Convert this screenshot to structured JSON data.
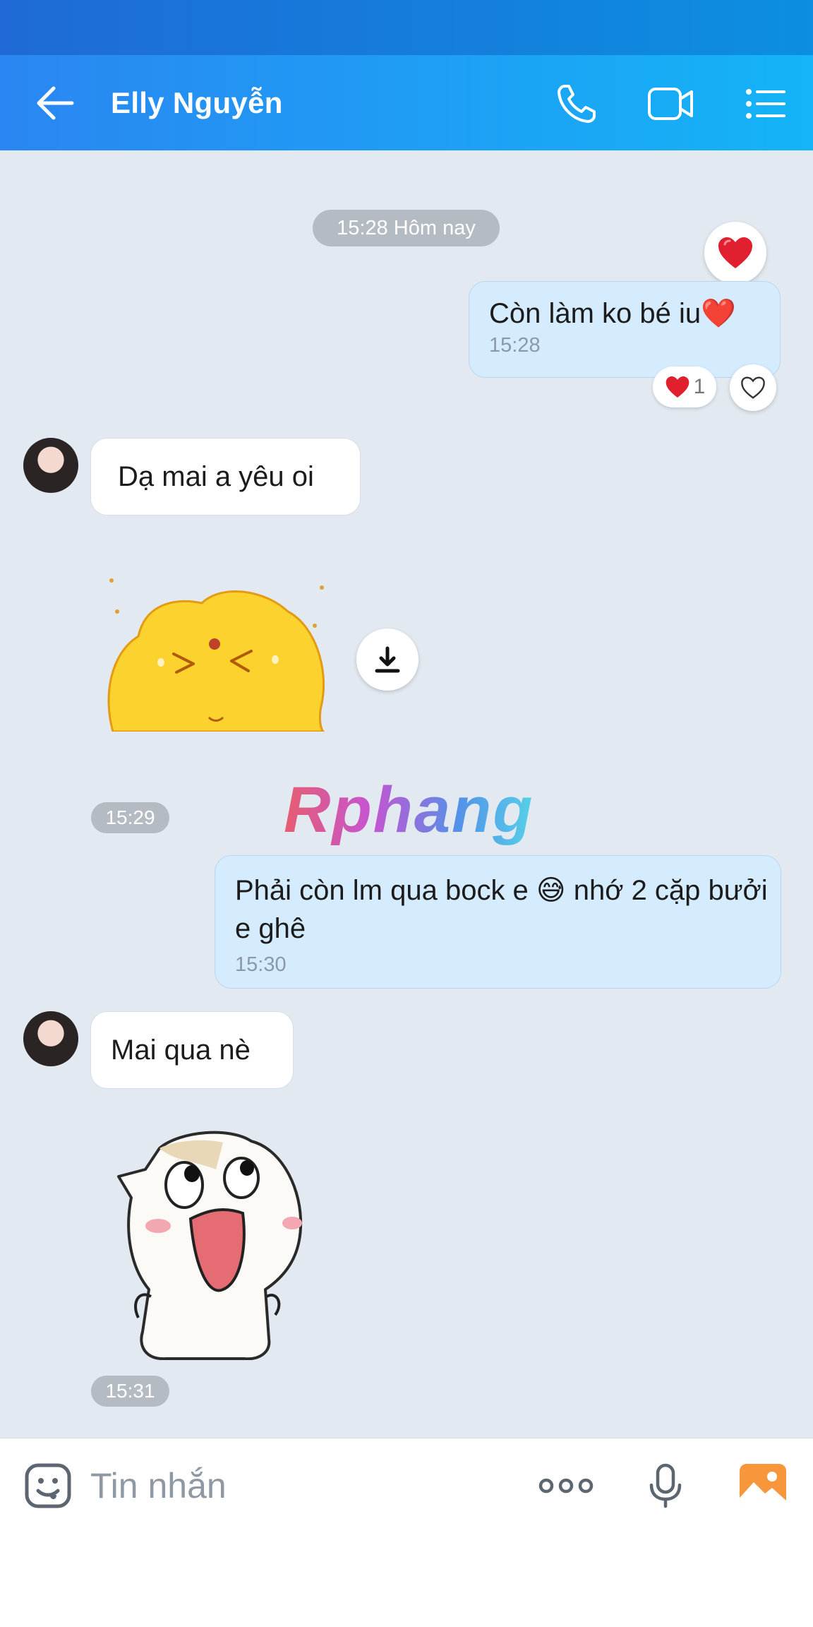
{
  "header": {
    "title": "Elly Nguyễn"
  },
  "date_separator": "15:28 Hôm nay",
  "messages": [
    {
      "from": "me",
      "text": "Còn làm ko bé iu❤️",
      "time": "15:28",
      "reaction_count": "1"
    },
    {
      "from": "them",
      "text": "Dạ mai a yêu oi"
    },
    {
      "from": "them",
      "type": "sticker",
      "sticker": "yellow-blob-sticker",
      "time": "15:29"
    },
    {
      "from": "me",
      "text": "Phải còn lm qua bock e 😅 nhớ 2 cặp bưởi e ghê",
      "time": "15:30"
    },
    {
      "from": "them",
      "text": "Mai qua nè"
    },
    {
      "from": "them",
      "type": "sticker",
      "sticker": "white-cat-laughing-sticker",
      "time": "15:31"
    }
  ],
  "watermark": "Rphang",
  "composer": {
    "placeholder": "Tin nhắn"
  },
  "icons": [
    "back-arrow-icon",
    "phone-icon",
    "video-call-icon",
    "menu-list-icon",
    "heart-icon",
    "download-icon",
    "emoji-icon",
    "more-icon",
    "microphone-icon",
    "image-icon"
  ],
  "colors": {
    "header_start": "#2a86f2",
    "header_end": "#14b4f6",
    "chat_background": "#e3e9f1",
    "my_bubble": "#d5ecff",
    "their_bubble": "#ffffff",
    "heart": "#e0202e"
  }
}
